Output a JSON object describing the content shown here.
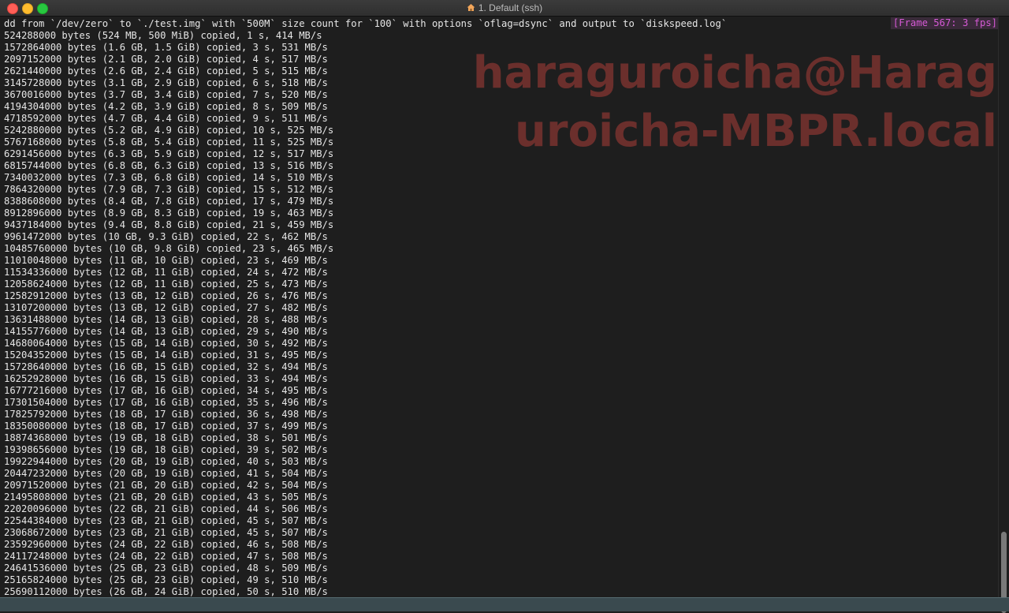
{
  "window": {
    "title": "1. Default (ssh)"
  },
  "terminal": {
    "frame_badge": "[Frame 567: 3 fps]",
    "watermark_line1": "haraguroicha@Harag",
    "watermark_line2": "uroicha-MBPR.local",
    "lines": [
      "dd from `/dev/zero` to `./test.img` with `500M` size count for `100` with options `oflag=dsync` and output to `diskspeed.log`",
      "524288000 bytes (524 MB, 500 MiB) copied, 1 s, 414 MB/s",
      "1572864000 bytes (1.6 GB, 1.5 GiB) copied, 3 s, 531 MB/s",
      "2097152000 bytes (2.1 GB, 2.0 GiB) copied, 4 s, 517 MB/s",
      "2621440000 bytes (2.6 GB, 2.4 GiB) copied, 5 s, 515 MB/s",
      "3145728000 bytes (3.1 GB, 2.9 GiB) copied, 6 s, 518 MB/s",
      "3670016000 bytes (3.7 GB, 3.4 GiB) copied, 7 s, 520 MB/s",
      "4194304000 bytes (4.2 GB, 3.9 GiB) copied, 8 s, 509 MB/s",
      "4718592000 bytes (4.7 GB, 4.4 GiB) copied, 9 s, 511 MB/s",
      "5242880000 bytes (5.2 GB, 4.9 GiB) copied, 10 s, 525 MB/s",
      "5767168000 bytes (5.8 GB, 5.4 GiB) copied, 11 s, 525 MB/s",
      "6291456000 bytes (6.3 GB, 5.9 GiB) copied, 12 s, 517 MB/s",
      "6815744000 bytes (6.8 GB, 6.3 GiB) copied, 13 s, 516 MB/s",
      "7340032000 bytes (7.3 GB, 6.8 GiB) copied, 14 s, 510 MB/s",
      "7864320000 bytes (7.9 GB, 7.3 GiB) copied, 15 s, 512 MB/s",
      "8388608000 bytes (8.4 GB, 7.8 GiB) copied, 17 s, 479 MB/s",
      "8912896000 bytes (8.9 GB, 8.3 GiB) copied, 19 s, 463 MB/s",
      "9437184000 bytes (9.4 GB, 8.8 GiB) copied, 21 s, 459 MB/s",
      "9961472000 bytes (10 GB, 9.3 GiB) copied, 22 s, 462 MB/s",
      "10485760000 bytes (10 GB, 9.8 GiB) copied, 23 s, 465 MB/s",
      "11010048000 bytes (11 GB, 10 GiB) copied, 23 s, 469 MB/s",
      "11534336000 bytes (12 GB, 11 GiB) copied, 24 s, 472 MB/s",
      "12058624000 bytes (12 GB, 11 GiB) copied, 25 s, 473 MB/s",
      "12582912000 bytes (13 GB, 12 GiB) copied, 26 s, 476 MB/s",
      "13107200000 bytes (13 GB, 12 GiB) copied, 27 s, 482 MB/s",
      "13631488000 bytes (14 GB, 13 GiB) copied, 28 s, 488 MB/s",
      "14155776000 bytes (14 GB, 13 GiB) copied, 29 s, 490 MB/s",
      "14680064000 bytes (15 GB, 14 GiB) copied, 30 s, 492 MB/s",
      "15204352000 bytes (15 GB, 14 GiB) copied, 31 s, 495 MB/s",
      "15728640000 bytes (16 GB, 15 GiB) copied, 32 s, 494 MB/s",
      "16252928000 bytes (16 GB, 15 GiB) copied, 33 s, 494 MB/s",
      "16777216000 bytes (17 GB, 16 GiB) copied, 34 s, 495 MB/s",
      "17301504000 bytes (17 GB, 16 GiB) copied, 35 s, 496 MB/s",
      "17825792000 bytes (18 GB, 17 GiB) copied, 36 s, 498 MB/s",
      "18350080000 bytes (18 GB, 17 GiB) copied, 37 s, 499 MB/s",
      "18874368000 bytes (19 GB, 18 GiB) copied, 38 s, 501 MB/s",
      "19398656000 bytes (19 GB, 18 GiB) copied, 39 s, 502 MB/s",
      "19922944000 bytes (20 GB, 19 GiB) copied, 40 s, 503 MB/s",
      "20447232000 bytes (20 GB, 19 GiB) copied, 41 s, 504 MB/s",
      "20971520000 bytes (21 GB, 20 GiB) copied, 42 s, 504 MB/s",
      "21495808000 bytes (21 GB, 20 GiB) copied, 43 s, 505 MB/s",
      "22020096000 bytes (22 GB, 21 GiB) copied, 44 s, 506 MB/s",
      "22544384000 bytes (23 GB, 21 GiB) copied, 45 s, 507 MB/s",
      "23068672000 bytes (23 GB, 21 GiB) copied, 45 s, 507 MB/s",
      "23592960000 bytes (24 GB, 22 GiB) copied, 46 s, 508 MB/s",
      "24117248000 bytes (24 GB, 22 GiB) copied, 47 s, 508 MB/s",
      "24641536000 bytes (25 GB, 23 GiB) copied, 48 s, 509 MB/s",
      "25165824000 bytes (25 GB, 23 GiB) copied, 49 s, 510 MB/s",
      "25690112000 bytes (26 GB, 24 GiB) copied, 50 s, 510 MB/s"
    ]
  }
}
